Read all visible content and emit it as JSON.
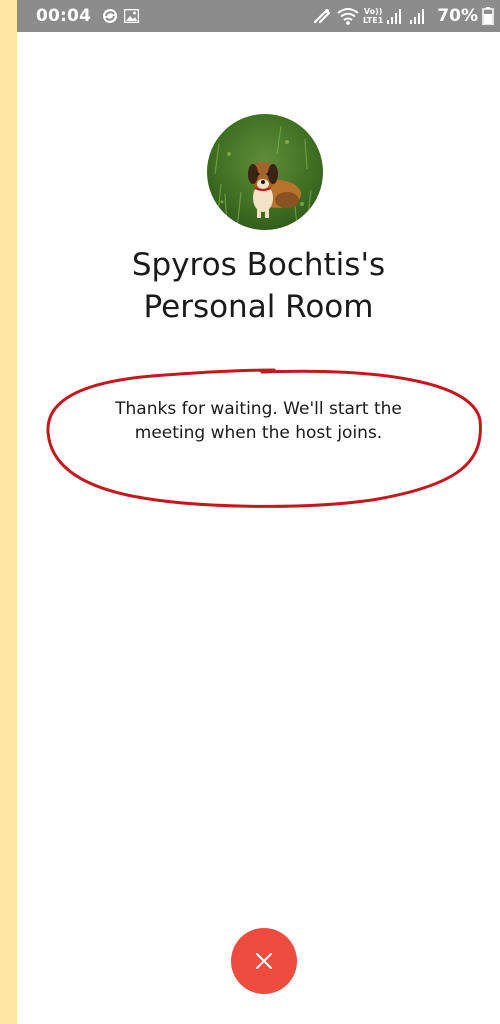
{
  "status_bar": {
    "time": "00:04",
    "icons_left": [
      "sync-icon",
      "image-icon"
    ],
    "icons_right": [
      "nfc-icon",
      "wifi-icon",
      "volte-lte-icon",
      "signal-icon",
      "signal-icon-2"
    ],
    "volte_label": "Vo))",
    "lte_label": "LTE1",
    "battery_percent": "70%",
    "background_color": "#8c8c8c"
  },
  "room": {
    "avatar_icon": "dog-photo-avatar",
    "title_line1": "Spyros Bochtis's",
    "title_line2": "Personal Room"
  },
  "waiting": {
    "message_line1": "Thanks for waiting. We'll start the",
    "message_line2": "meeting when the host joins.",
    "annotation_color": "#c8161d"
  },
  "controls": {
    "leave_icon": "close-icon",
    "leave_color": "#ef4b3f"
  },
  "page": {
    "side_strip_color": "#ffe8a6"
  }
}
